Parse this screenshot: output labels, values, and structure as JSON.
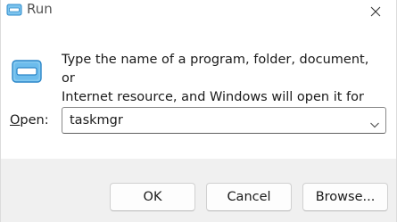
{
  "window": {
    "title": "Run",
    "icons": {
      "title_icon": "run-icon",
      "close_icon": "close-icon",
      "big_icon": "run-icon",
      "dropdown_icon": "chevron-down-icon"
    }
  },
  "description": {
    "line1": "Type the name of a program, folder, document, or",
    "line2": "Internet resource, and Windows will open it for you."
  },
  "open_field": {
    "label_accel": "O",
    "label_rest": "pen:",
    "value": "taskmgr"
  },
  "buttons": {
    "ok": "OK",
    "cancel": "Cancel",
    "browse": "Browse..."
  },
  "colors": {
    "accent": "#0a6bc4",
    "icon_light": "#7cc4ee"
  }
}
